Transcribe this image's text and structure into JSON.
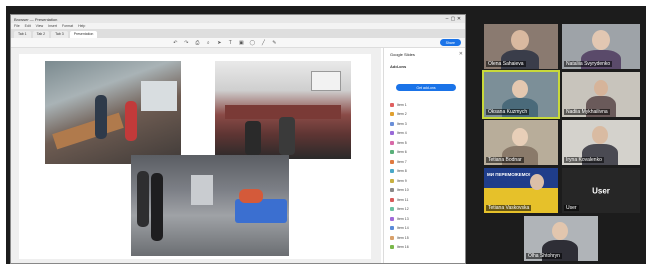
{
  "window": {
    "title": "Browser — Presentation",
    "controls": [
      "–",
      "▢",
      "✕"
    ],
    "menu": [
      "File",
      "Edit",
      "View",
      "Insert",
      "Format",
      "Help"
    ],
    "tabs": [
      "Tab 1",
      "Tab 2",
      "Tab 3",
      "Presentation"
    ],
    "share_label": "Share"
  },
  "side_panel": {
    "title": "Google Slides",
    "heading": "Add-ons",
    "description": "",
    "button_label": "Get add-ons",
    "items": [
      {
        "label": "Item 1",
        "color": "#e06060"
      },
      {
        "label": "Item 2",
        "color": "#e0a030"
      },
      {
        "label": "Item 3",
        "color": "#6a8fd8"
      },
      {
        "label": "Item 4",
        "color": "#9a6ad8"
      },
      {
        "label": "Item 5",
        "color": "#d86aa8"
      },
      {
        "label": "Item 6",
        "color": "#5ab07a"
      },
      {
        "label": "Item 7",
        "color": "#e07a40"
      },
      {
        "label": "Item 8",
        "color": "#4aa8c8"
      },
      {
        "label": "Item 9",
        "color": "#c8b040"
      },
      {
        "label": "Item 10",
        "color": "#8a8a8a"
      },
      {
        "label": "Item 11",
        "color": "#d85a5a"
      },
      {
        "label": "Item 12",
        "color": "#6ac0a0"
      },
      {
        "label": "Item 13",
        "color": "#a06ad8"
      },
      {
        "label": "Item 14",
        "color": "#5a8ad8"
      },
      {
        "label": "Item 15",
        "color": "#d8a06a"
      },
      {
        "label": "Item 16",
        "color": "#7ab84a"
      }
    ],
    "footer": ""
  },
  "participants": [
    {
      "name": "Olena Sahaieva",
      "kind": "video"
    },
    {
      "name": "Nataliia Svyrydenko",
      "kind": "video"
    },
    {
      "name": "Oksana Kuzmych",
      "kind": "video",
      "active": true
    },
    {
      "name": "Nadiia Mykhailivna",
      "kind": "video"
    },
    {
      "name": "Tetiana Bodnar",
      "kind": "video"
    },
    {
      "name": "Iryna Kovalenko",
      "kind": "video"
    },
    {
      "name": "Tetiana Vaskovska",
      "kind": "banner",
      "banner_line1": "МИ ПЕРЕМОЖЕМО!",
      "banner_line2": "ВСЕ БУДЕ УКРАЇНА!"
    },
    {
      "name": "User",
      "kind": "name_only"
    },
    {
      "name": "Olha Shtohryn",
      "kind": "video"
    }
  ]
}
